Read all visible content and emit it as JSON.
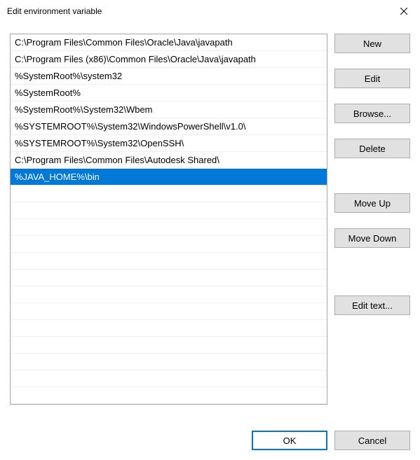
{
  "title": "Edit environment variable",
  "list": {
    "items": [
      "C:\\Program Files\\Common Files\\Oracle\\Java\\javapath",
      "C:\\Program Files (x86)\\Common Files\\Oracle\\Java\\javapath",
      "%SystemRoot%\\system32",
      "%SystemRoot%",
      "%SystemRoot%\\System32\\Wbem",
      "%SYSTEMROOT%\\System32\\WindowsPowerShell\\v1.0\\",
      "%SYSTEMROOT%\\System32\\OpenSSH\\",
      "C:\\Program Files\\Common Files\\Autodesk Shared\\",
      "%JAVA_HOME%\\bin"
    ],
    "selected_index": 8
  },
  "buttons": {
    "new": "New",
    "edit": "Edit",
    "browse": "Browse...",
    "delete": "Delete",
    "move_up": "Move Up",
    "move_down": "Move Down",
    "edit_text": "Edit text...",
    "ok": "OK",
    "cancel": "Cancel"
  }
}
